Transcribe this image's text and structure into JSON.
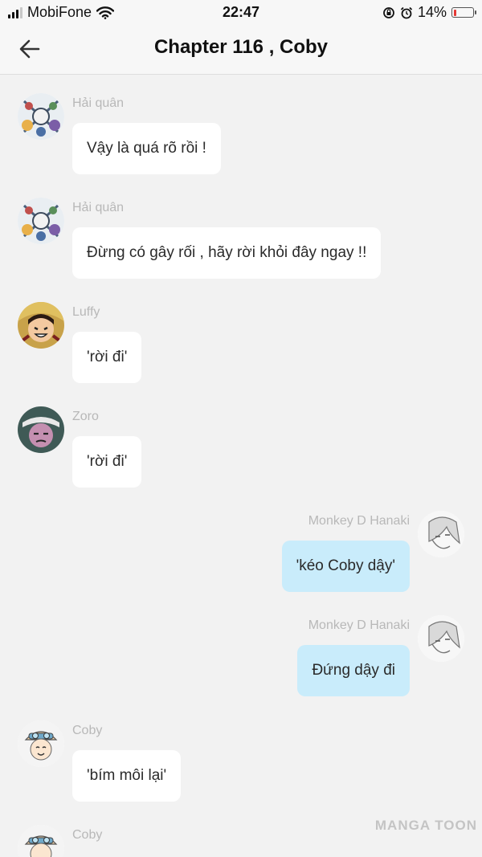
{
  "status_bar": {
    "carrier": "MobiFone",
    "time": "22:47",
    "battery_percent_label": "14%",
    "battery_level": 0.14
  },
  "header": {
    "title": "Chapter 116 , Coby"
  },
  "messages": [
    {
      "sender": "Hải quân",
      "text": "Vậy là quá rõ rồi !",
      "side": "left",
      "avatar_icon": "marines-avatar-icon"
    },
    {
      "sender": "Hải quân",
      "text": "Đừng có gây rối , hãy rời khỏi đây ngay !!",
      "side": "left",
      "avatar_icon": "marines-avatar-icon"
    },
    {
      "sender": "Luffy",
      "text": "'rời đi'",
      "side": "left",
      "avatar_icon": "luffy-avatar-icon"
    },
    {
      "sender": "Zoro",
      "text": "'rời đi'",
      "side": "left",
      "avatar_icon": "zoro-avatar-icon"
    },
    {
      "sender": "Monkey D Hanaki",
      "text": "'kéo Coby dậy'",
      "side": "right",
      "avatar_icon": "hanaki-avatar-icon"
    },
    {
      "sender": "Monkey D Hanaki",
      "text": "Đứng dậy đi",
      "side": "right",
      "avatar_icon": "hanaki-avatar-icon"
    },
    {
      "sender": "Coby",
      "text": "'bím môi lại'",
      "side": "left",
      "avatar_icon": "coby-avatar-icon"
    },
    {
      "sender": "Coby",
      "text": "",
      "side": "left",
      "avatar_icon": "coby-avatar-icon"
    }
  ],
  "watermark": "MANGA TOON",
  "colors": {
    "background": "#f2f2f2",
    "bubble_left": "#ffffff",
    "bubble_right": "#c9ecfb",
    "sender_name": "#b8b8b8",
    "battery_low": "#e53935"
  }
}
